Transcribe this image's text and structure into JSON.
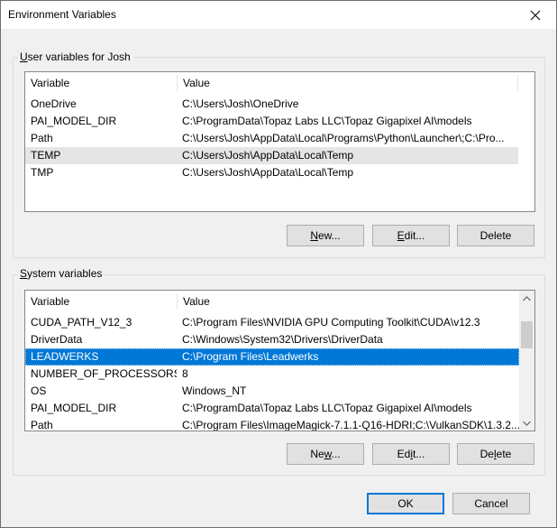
{
  "window": {
    "title": "Environment Variables"
  },
  "user_vars": {
    "group_label_prefix": "",
    "group_label_key": "U",
    "group_label_rest": "ser variables for Josh",
    "col_variable": "Variable",
    "col_value": "Value",
    "rows": [
      {
        "name": "OneDrive",
        "value": "C:\\Users\\Josh\\OneDrive"
      },
      {
        "name": "PAI_MODEL_DIR",
        "value": "C:\\ProgramData\\Topaz Labs LLC\\Topaz Gigapixel AI\\models"
      },
      {
        "name": "Path",
        "value": "C:\\Users\\Josh\\AppData\\Local\\Programs\\Python\\Launcher\\;C:\\Pro..."
      },
      {
        "name": "TEMP",
        "value": "C:\\Users\\Josh\\AppData\\Local\\Temp"
      },
      {
        "name": "TMP",
        "value": "C:\\Users\\Josh\\AppData\\Local\\Temp"
      }
    ],
    "buttons": {
      "new_key": "N",
      "new_rest": "ew...",
      "edit_key": "E",
      "edit_rest": "dit...",
      "delete_label": "Delete"
    }
  },
  "system_vars": {
    "group_label_key": "S",
    "group_label_rest": "ystem variables",
    "col_variable": "Variable",
    "col_value": "Value",
    "rows": [
      {
        "name": "CUDA_PATH_V12_3",
        "value": "C:\\Program Files\\NVIDIA GPU Computing Toolkit\\CUDA\\v12.3"
      },
      {
        "name": "DriverData",
        "value": "C:\\Windows\\System32\\Drivers\\DriverData"
      },
      {
        "name": "LEADWERKS",
        "value": "C:\\Program Files\\Leadwerks"
      },
      {
        "name": "NUMBER_OF_PROCESSORS",
        "value": "8"
      },
      {
        "name": "OS",
        "value": "Windows_NT"
      },
      {
        "name": "PAI_MODEL_DIR",
        "value": "C:\\ProgramData\\Topaz Labs LLC\\Topaz Gigapixel AI\\models"
      },
      {
        "name": "Path",
        "value": "C:\\Program Files\\ImageMagick-7.1.1-Q16-HDRI;C:\\VulkanSDK\\1.3.2..."
      }
    ],
    "buttons": {
      "new_pre": "Ne",
      "new_key": "w",
      "new_rest": "...",
      "edit_pre": "Ed",
      "edit_key": "i",
      "edit_rest": "t...",
      "delete_pre": "De",
      "delete_key": "l",
      "delete_rest": "ete"
    }
  },
  "footer": {
    "ok_label": "OK",
    "cancel_label": "Cancel"
  },
  "colors": {
    "selection": "#0078d7",
    "hover": "#e5e5e5",
    "default_button_border": "#0078d7"
  }
}
